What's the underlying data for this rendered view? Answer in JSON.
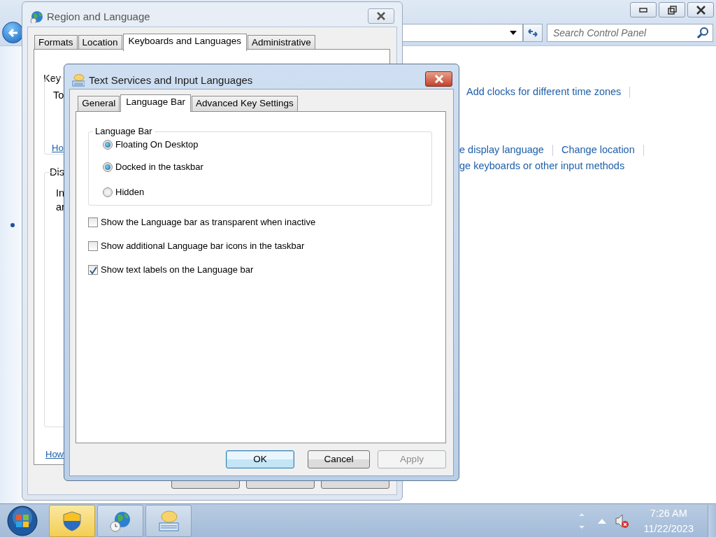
{
  "control_panel": {
    "search": {
      "placeholder": "Search Control Panel"
    },
    "link_rows": [
      [
        "Add clocks for different time zones"
      ],
      [
        "e display language",
        "Change location"
      ],
      [
        "ge keyboards or other input methods"
      ]
    ]
  },
  "region_dialog": {
    "title": "Region and Language",
    "tabs": [
      {
        "label": "Formats",
        "selected": false
      },
      {
        "label": "Location",
        "selected": false
      },
      {
        "label": "Keyboards and Languages",
        "selected": true
      },
      {
        "label": "Administrative",
        "selected": false
      }
    ],
    "fragments": [
      {
        "text": "Key",
        "kind": "group"
      },
      {
        "text": "To",
        "kind": "text"
      },
      {
        "text": "Ho",
        "kind": "link"
      },
      {
        "text": "Dis",
        "kind": "group"
      },
      {
        "text": "In",
        "kind": "text"
      },
      {
        "text": "ar",
        "kind": "text"
      },
      {
        "text": "How",
        "kind": "link"
      }
    ]
  },
  "text_services_dialog": {
    "title": "Text Services and Input Languages",
    "tabs": [
      {
        "label": "General",
        "selected": false
      },
      {
        "label": "Language Bar",
        "selected": true
      },
      {
        "label": "Advanced Key Settings",
        "selected": false
      }
    ],
    "group": {
      "title": "Language Bar",
      "radios": [
        {
          "label": "Floating On Desktop",
          "selected": true
        },
        {
          "label": "Docked in the taskbar",
          "selected": true
        },
        {
          "label": "Hidden",
          "selected": false
        }
      ]
    },
    "checkboxes": [
      {
        "label": "Show the Language bar as transparent when inactive",
        "checked": false
      },
      {
        "label": "Show additional Language bar icons in the taskbar",
        "checked": false
      },
      {
        "label": "Show text labels on the Language bar",
        "checked": true
      }
    ],
    "buttons": [
      {
        "label": "OK",
        "kind": "default",
        "disabled": false
      },
      {
        "label": "Cancel",
        "kind": "normal",
        "disabled": false
      },
      {
        "label": "Apply",
        "kind": "normal",
        "disabled": true
      }
    ]
  },
  "taskbar": {
    "buttons": [
      {
        "kind": "shield",
        "active": true
      },
      {
        "kind": "globe-clock",
        "active": false
      },
      {
        "kind": "keyboard",
        "active": false
      }
    ],
    "time": "7:26 AM",
    "date": "11/22/2023"
  }
}
